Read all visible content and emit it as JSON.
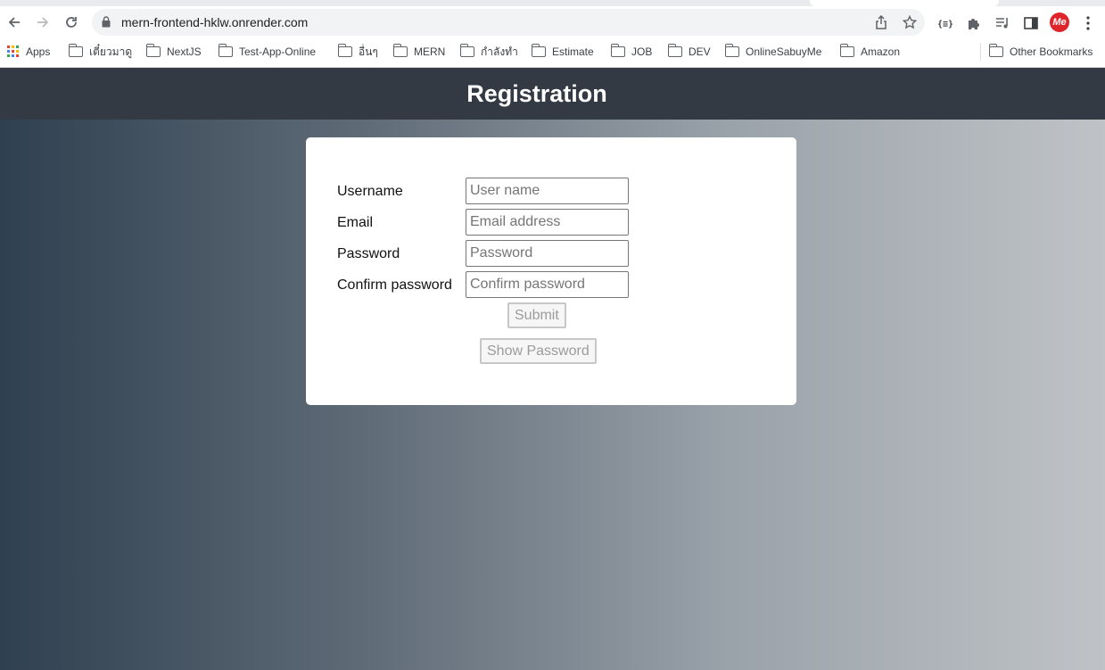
{
  "browser": {
    "url": "mern-frontend-hklw.onrender.com",
    "profile_initials": "Me",
    "bookmarks": [
      {
        "label": "Apps",
        "icon": "apps-grid-icon"
      },
      {
        "label": "เตี๋ยวมาดู",
        "icon": "folder-icon"
      },
      {
        "label": "NextJS",
        "icon": "folder-icon"
      },
      {
        "label": "Test-App-Online",
        "icon": "folder-icon"
      },
      {
        "label": "อื่นๆ",
        "icon": "folder-icon"
      },
      {
        "label": "MERN",
        "icon": "folder-icon"
      },
      {
        "label": "กำลังทำ",
        "icon": "folder-icon"
      },
      {
        "label": "Estimate",
        "icon": "folder-icon"
      },
      {
        "label": "JOB",
        "icon": "folder-icon"
      },
      {
        "label": "DEV",
        "icon": "folder-icon"
      },
      {
        "label": "OnlineSabuyMe",
        "icon": "folder-icon"
      },
      {
        "label": "Amazon",
        "icon": "folder-icon"
      }
    ],
    "other_bookmarks": "Other Bookmarks"
  },
  "page": {
    "title": "Registration",
    "form": {
      "fields": [
        {
          "label": "Username",
          "placeholder": "User name",
          "value": ""
        },
        {
          "label": "Email",
          "placeholder": "Email address",
          "value": ""
        },
        {
          "label": "Password",
          "placeholder": "Password",
          "value": ""
        },
        {
          "label": "Confirm password",
          "placeholder": "Confirm password",
          "value": ""
        }
      ],
      "submit_label": "Submit",
      "show_password_label": "Show Password"
    }
  },
  "colors": {
    "header_bg": "#343a43",
    "gradient_start": "#2f4050",
    "gradient_end": "#bfc3c6"
  }
}
